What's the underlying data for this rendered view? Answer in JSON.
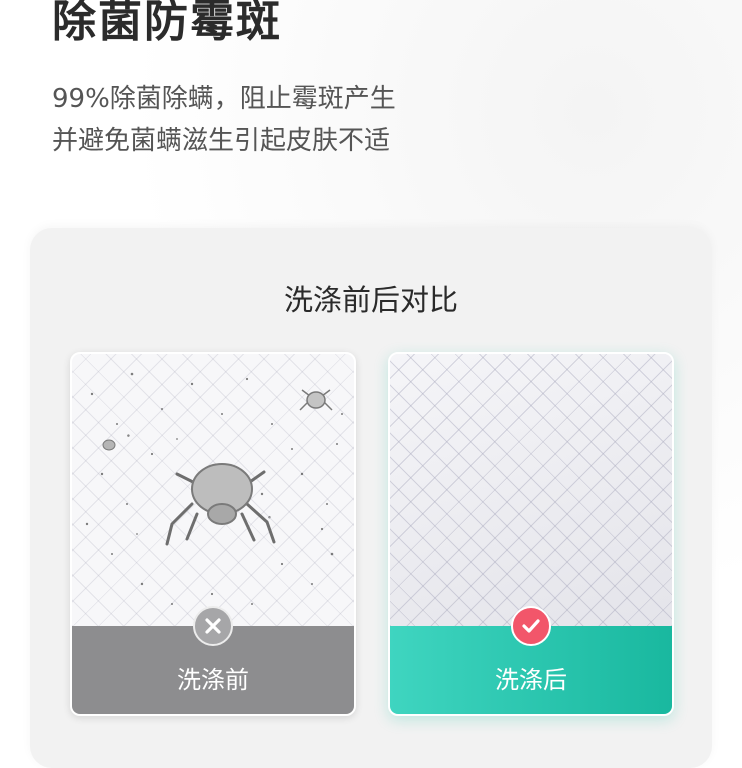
{
  "headline": "除菌防霉斑",
  "description": {
    "line1": "99%除菌除螨，阻止霉斑产生",
    "line2": "并避免菌螨滋生引起皮肤不适"
  },
  "comparison": {
    "title": "洗涤前后对比",
    "before": {
      "label": "洗涤前",
      "icon": "x-icon"
    },
    "after": {
      "label": "洗涤后",
      "icon": "check-icon"
    }
  },
  "colors": {
    "after_accent": "#22c1a8",
    "check_badge": "#f2566a",
    "before_footer": "#8d8d8f"
  }
}
